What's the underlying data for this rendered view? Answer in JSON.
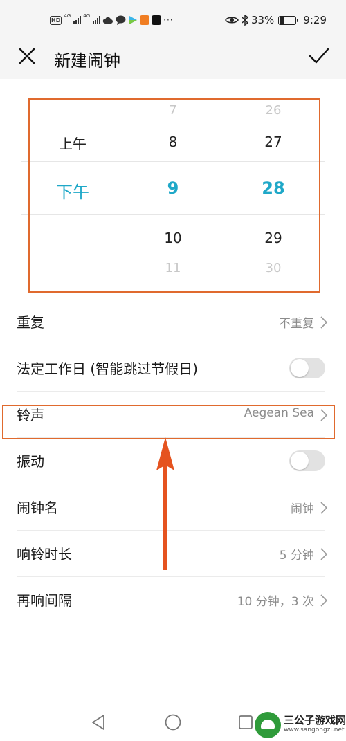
{
  "status_bar": {
    "left_label": "HD",
    "net_label_1": "4G",
    "net_label_2": "4G",
    "more": "···",
    "battery_text": "33%",
    "battery_level": 0.33,
    "time": "9:29",
    "icons": [
      "hd-icon",
      "signal-icon",
      "cloud-icon",
      "chat-icon",
      "play-icon",
      "video-icon",
      "tiktok-icon",
      "eye-icon",
      "bluetooth-icon",
      "battery-icon"
    ]
  },
  "header": {
    "title": "新建闹钟",
    "close_icon": "close-icon",
    "confirm_icon": "check-icon"
  },
  "picker": {
    "ampm": {
      "above": "上午",
      "selected": "下午"
    },
    "hours": {
      "above2": "7",
      "above1": "8",
      "selected": "9",
      "below1": "10",
      "below2": "11"
    },
    "minutes": {
      "above2": "26",
      "above1": "27",
      "selected": "28",
      "below1": "29",
      "below2": "30"
    },
    "accent_color": "#1fa8c8"
  },
  "settings": {
    "repeat": {
      "label": "重复",
      "value": "不重复"
    },
    "workday": {
      "label": "法定工作日 (智能跳过节假日)",
      "enabled": false
    },
    "ringtone": {
      "label": "铃声",
      "value": "Aegean Sea"
    },
    "vibrate": {
      "label": "振动",
      "enabled": false
    },
    "alarm_name": {
      "label": "闹钟名",
      "value": "闹钟"
    },
    "ring_duration": {
      "label": "响铃时长",
      "value": "5 分钟"
    },
    "snooze": {
      "label": "再响间隔",
      "value": "10 分钟，3 次"
    }
  },
  "annotation_color": "#e06a2e",
  "navbar": {
    "icons": [
      "back-icon",
      "home-icon",
      "recent-apps-icon"
    ]
  },
  "watermark": {
    "title": "三公子游戏网",
    "url": "www.sangongzi.net"
  }
}
